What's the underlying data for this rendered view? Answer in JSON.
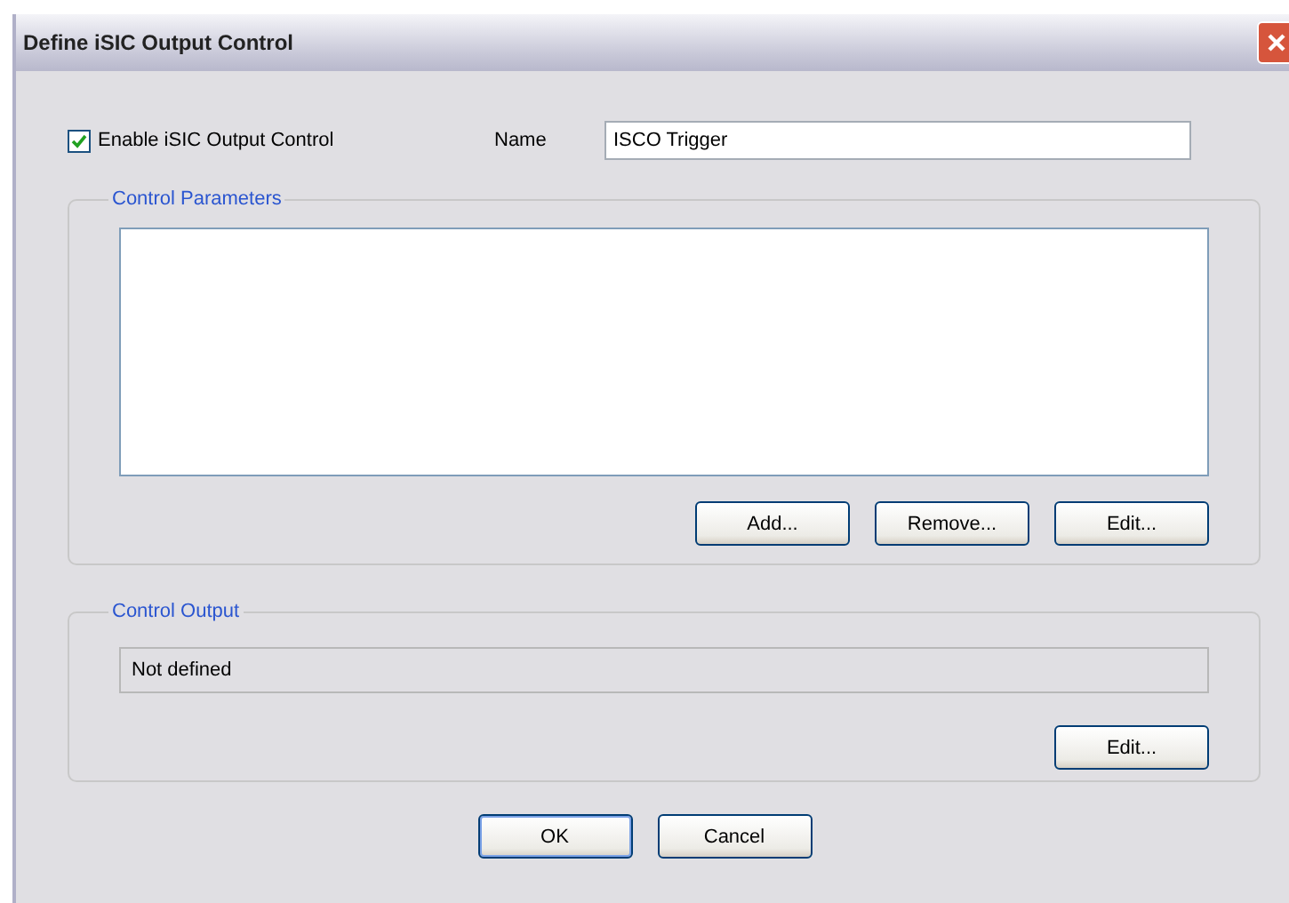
{
  "window": {
    "title": "Define iSIC Output Control"
  },
  "enable": {
    "label": "Enable iSIC Output Control",
    "checked": true
  },
  "name": {
    "label": "Name",
    "value": "ISCO Trigger"
  },
  "control_parameters": {
    "title": "Control Parameters",
    "buttons": [
      "Add...",
      "Remove...",
      "Edit..."
    ]
  },
  "control_output": {
    "title": "Control Output",
    "value": "Not defined",
    "buttons": [
      "Edit..."
    ]
  },
  "buttons": [
    "OK",
    "Cancel"
  ]
}
